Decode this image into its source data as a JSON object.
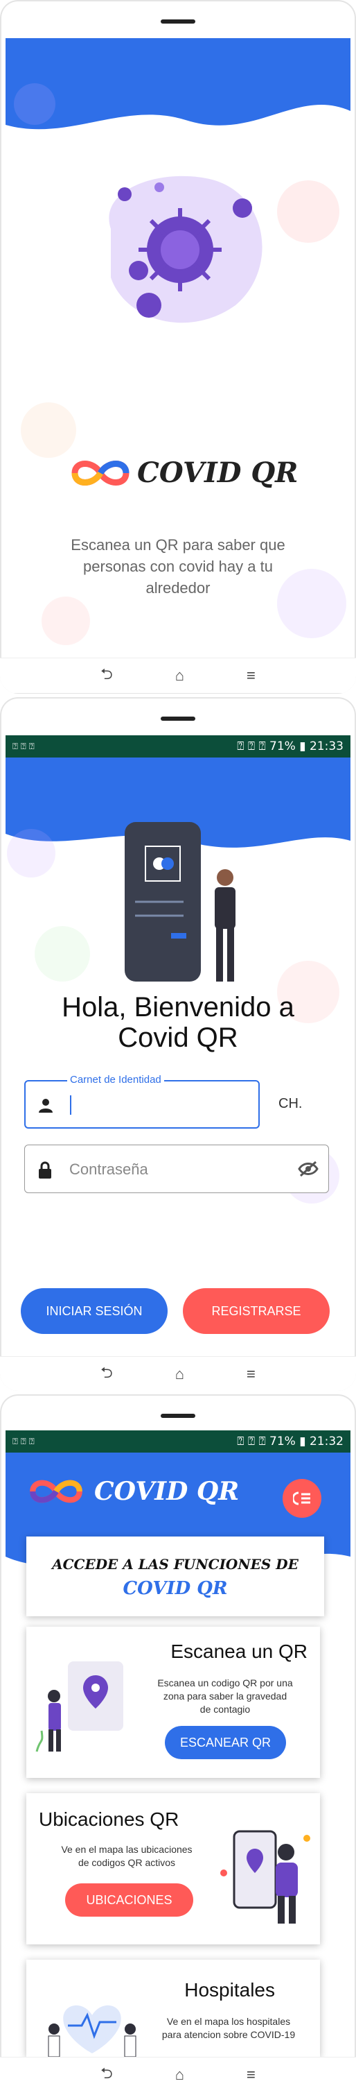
{
  "splash": {
    "brand": "COVID QR",
    "tagline_1": "Escanea un QR para saber que",
    "tagline_2": "personas con covid hay a tu",
    "tagline_3": "alrededor"
  },
  "navbar": {
    "back": "⮌",
    "home": "⌂",
    "menu": "≡"
  },
  "status": {
    "left_icons": "⍰ ⍰ ⍰",
    "right": "⍰ ⍰ ⍰ 71% ▮ 21:33",
    "right2": "⍰ ⍰ ⍰ 71% ▮ 21:32"
  },
  "login": {
    "welcome_1": "Hola, Bienvenido a",
    "welcome_2": "Covid QR",
    "ci_label": "Carnet de Identidad",
    "ci_suffix": "CH.",
    "password_placeholder": "Contraseña",
    "login_button": "INICIAR SESIÓN",
    "register_button": "REGISTRARSE"
  },
  "home": {
    "brand": "COVID QR",
    "banner_1": "ACCEDE A LAS FUNCIONES DE",
    "banner_2": "COVID QR",
    "cards": [
      {
        "title": "Escanea un QR",
        "desc_1": "Escanea un codigo QR por una",
        "desc_2": "zona para saber la gravedad",
        "desc_3": "de contagio",
        "button": "ESCANEAR QR"
      },
      {
        "title": "Ubicaciones QR",
        "desc_1": "Ve en el mapa las ubicaciones",
        "desc_2": "de codigos QR activos",
        "desc_3": "",
        "button": "UBICACIONES"
      },
      {
        "title": "Hospitales",
        "desc_1": "Ve en el mapa los hospitales",
        "desc_2": "para atencion sobre COVID-19",
        "desc_3": "",
        "button": ""
      }
    ]
  },
  "colors": {
    "blue": "#2f6fe8",
    "red": "#ff5a57",
    "purple": "#6b45c4",
    "dark_green": "#0c4e3a"
  }
}
